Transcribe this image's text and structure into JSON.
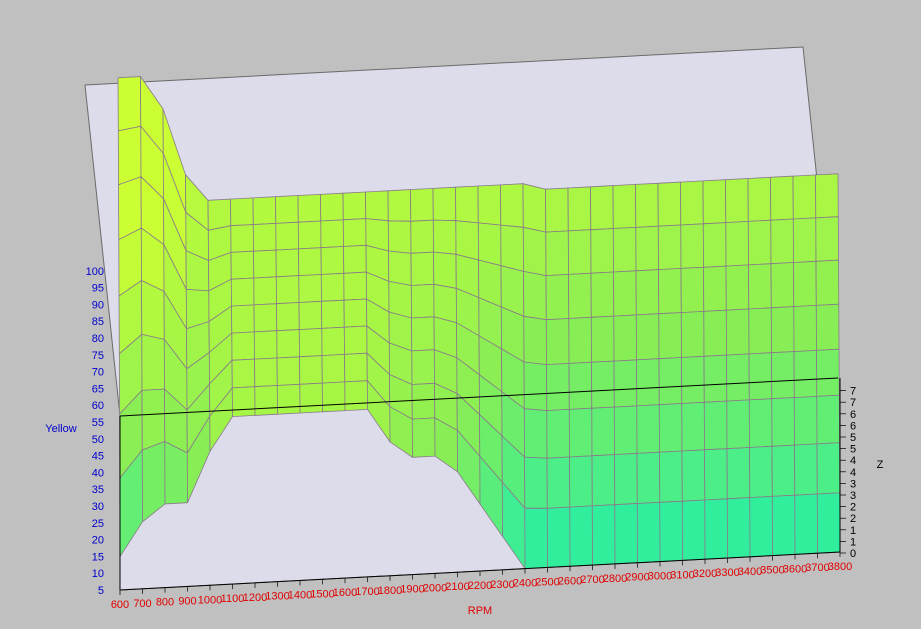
{
  "chart_data": {
    "type": "surface3d",
    "xlabel": "RPM",
    "ylabel": "Yellow",
    "zlabel": "Z",
    "x_ticks": [
      "600",
      "700",
      "800",
      "900",
      "1000",
      "1100",
      "1200",
      "1300",
      "1400",
      "1500",
      "1600",
      "1700",
      "1800",
      "1900",
      "2000",
      "2100",
      "2200",
      "2300",
      "2400",
      "2500",
      "2600",
      "2700",
      "2800",
      "2900",
      "3000",
      "3100",
      "3200",
      "3300",
      "3400",
      "3500",
      "3600",
      "3700",
      "3800"
    ],
    "y_ticks": [
      "5",
      "10",
      "15",
      "20",
      "25",
      "30",
      "35",
      "40",
      "45",
      "50",
      "55",
      "60",
      "65",
      "70",
      "75",
      "80",
      "85",
      "90",
      "95",
      "100"
    ],
    "z_ticks": [
      "0",
      "1",
      "1",
      "2",
      "2",
      "3",
      "3",
      "4",
      "4",
      "5",
      "5",
      "6",
      "6",
      "7",
      "7"
    ],
    "z_range": [
      0,
      7
    ],
    "y_range": [
      5,
      100
    ],
    "x_range": [
      600,
      3800
    ],
    "depth_rows": 15,
    "surface": {
      "x": [
        600,
        700,
        800,
        900,
        1000,
        1100,
        1200,
        1300,
        1400,
        1500,
        1600,
        1700,
        1800,
        1900,
        2000,
        2100,
        2200,
        2300,
        2400,
        2500,
        2600,
        2700,
        2800,
        2900,
        3000,
        3100,
        3200,
        3300,
        3400,
        3500,
        3600,
        3700,
        3800
      ],
      "back_row_values": [
        100,
        100,
        90,
        70,
        62,
        62,
        62,
        62,
        62,
        62,
        62,
        62,
        62,
        62,
        62,
        62,
        62,
        62,
        62,
        60,
        60,
        60,
        60,
        60,
        60,
        60,
        60,
        60,
        60,
        60,
        60,
        60,
        60
      ],
      "front_row_values": [
        15,
        25,
        30,
        30,
        45,
        55,
        55,
        55,
        55,
        55,
        55,
        55,
        45,
        40,
        40,
        35,
        25,
        15,
        5,
        5,
        5,
        5,
        5,
        5,
        5,
        5,
        5,
        5,
        5,
        5,
        5,
        5,
        5
      ]
    },
    "colors": {
      "high": "#ccff33",
      "mid": "#88ee55",
      "low": "#22eeaa",
      "grid": "#8a7a8a",
      "axis_text_x": "#e00000",
      "axis_text_y": "#0000cc",
      "frame": "#d8d8e8"
    }
  }
}
